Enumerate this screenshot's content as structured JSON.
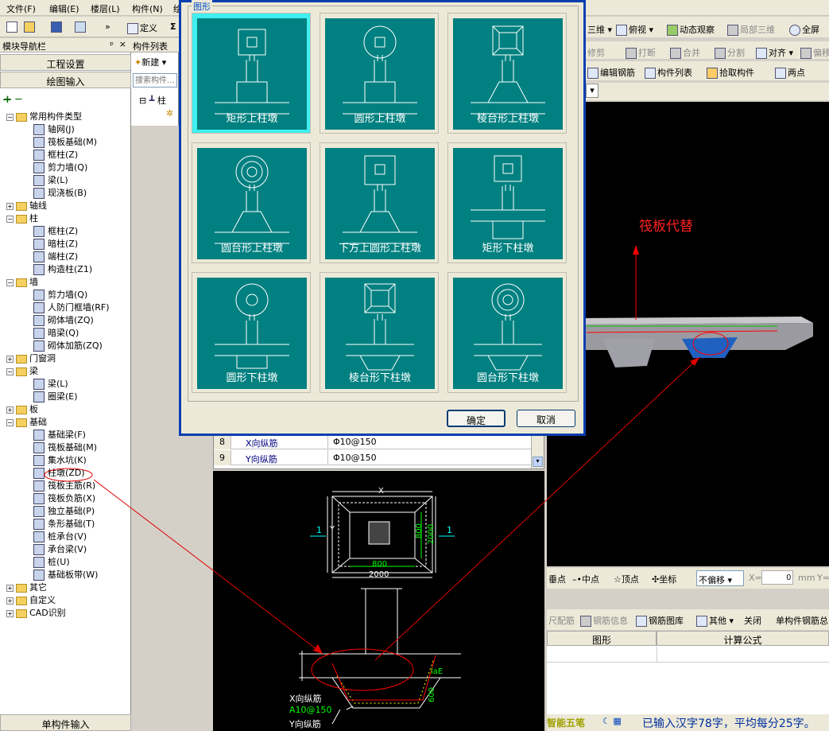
{
  "menu": [
    "文件(F)",
    "编辑(E)",
    "楼层(L)",
    "构件(N)",
    "绘"
  ],
  "toolbar": {
    "define_label": "定义",
    "sigma": "Σ",
    "chevron": "»"
  },
  "right_toolbar": {
    "row1": [
      "三维",
      "俯视",
      "动态观察",
      "局部三维",
      "全屏"
    ],
    "row2": [
      "修剪",
      "打断",
      "合并",
      "分割",
      "对齐",
      "偏移"
    ],
    "row3": [
      "编辑钢筋",
      "构件列表",
      "拾取构件",
      "两点"
    ]
  },
  "nav": {
    "title": "模块导航栏",
    "pin": "ᵖ",
    "close": "×",
    "project_settings": "工程设置",
    "drawing_input": "绘图输入",
    "single_input": "单构件输入",
    "tree": [
      {
        "label": "常用构件类型",
        "level": 0,
        "kind": "folder",
        "expanded": true
      },
      {
        "label": "轴网(J)",
        "level": 1,
        "kind": "item"
      },
      {
        "label": "筏板基础(M)",
        "level": 1,
        "kind": "item"
      },
      {
        "label": "框柱(Z)",
        "level": 1,
        "kind": "item"
      },
      {
        "label": "剪力墙(Q)",
        "level": 1,
        "kind": "item"
      },
      {
        "label": "梁(L)",
        "level": 1,
        "kind": "item"
      },
      {
        "label": "现浇板(B)",
        "level": 1,
        "kind": "item"
      },
      {
        "label": "轴线",
        "level": 0,
        "kind": "folder",
        "expanded": false
      },
      {
        "label": "柱",
        "level": 0,
        "kind": "folder",
        "expanded": true
      },
      {
        "label": "框柱(Z)",
        "level": 1,
        "kind": "item"
      },
      {
        "label": "暗柱(Z)",
        "level": 1,
        "kind": "item"
      },
      {
        "label": "端柱(Z)",
        "level": 1,
        "kind": "item"
      },
      {
        "label": "构造柱(Z1)",
        "level": 1,
        "kind": "item"
      },
      {
        "label": "墙",
        "level": 0,
        "kind": "folder",
        "expanded": true
      },
      {
        "label": "剪力墙(Q)",
        "level": 1,
        "kind": "item"
      },
      {
        "label": "人防门框墙(RF)",
        "level": 1,
        "kind": "item"
      },
      {
        "label": "砌体墙(ZQ)",
        "level": 1,
        "kind": "item"
      },
      {
        "label": "暗梁(Q)",
        "level": 1,
        "kind": "item"
      },
      {
        "label": "砌体加筋(ZQ)",
        "level": 1,
        "kind": "item"
      },
      {
        "label": "门窗洞",
        "level": 0,
        "kind": "folder",
        "expanded": false
      },
      {
        "label": "梁",
        "level": 0,
        "kind": "folder",
        "expanded": true
      },
      {
        "label": "梁(L)",
        "level": 1,
        "kind": "item"
      },
      {
        "label": "圈梁(E)",
        "level": 1,
        "kind": "item"
      },
      {
        "label": "板",
        "level": 0,
        "kind": "folder",
        "expanded": false
      },
      {
        "label": "基础",
        "level": 0,
        "kind": "folder",
        "expanded": true
      },
      {
        "label": "基础梁(F)",
        "level": 1,
        "kind": "item"
      },
      {
        "label": "筏板基础(M)",
        "level": 1,
        "kind": "item"
      },
      {
        "label": "集水坑(K)",
        "level": 1,
        "kind": "item"
      },
      {
        "label": "柱墩(ZD)",
        "level": 1,
        "kind": "item",
        "highlight": true
      },
      {
        "label": "筏板主筋(R)",
        "level": 1,
        "kind": "item"
      },
      {
        "label": "筏板负筋(X)",
        "level": 1,
        "kind": "item"
      },
      {
        "label": "独立基础(P)",
        "level": 1,
        "kind": "item"
      },
      {
        "label": "条形基础(T)",
        "level": 1,
        "kind": "item"
      },
      {
        "label": "桩承台(V)",
        "level": 1,
        "kind": "item"
      },
      {
        "label": "承台梁(V)",
        "level": 1,
        "kind": "item"
      },
      {
        "label": "桩(U)",
        "level": 1,
        "kind": "item"
      },
      {
        "label": "基础板带(W)",
        "level": 1,
        "kind": "item"
      },
      {
        "label": "其它",
        "level": 0,
        "kind": "folder",
        "expanded": false
      },
      {
        "label": "自定义",
        "level": 0,
        "kind": "folder",
        "expanded": false
      },
      {
        "label": "CAD识别",
        "level": 0,
        "kind": "folder",
        "expanded": false
      }
    ]
  },
  "component_list": {
    "title": "构件列表",
    "new_label": "新建",
    "search_placeholder": "搜索构件...",
    "root": "柱"
  },
  "dialog": {
    "group_label": "图形",
    "shapes": [
      "矩形上柱墩",
      "圆形上柱墩",
      "棱台形上柱墩",
      "圆台形上柱墩",
      "下方上圆形上柱墩",
      "矩形下柱墩",
      "圆形下柱墩",
      "棱台形下柱墩",
      "圆台形下柱墩"
    ],
    "ok": "确定",
    "cancel": "取消"
  },
  "properties": [
    {
      "no": "8",
      "name": "X向纵筋",
      "value": "Φ10@150"
    },
    {
      "no": "9",
      "name": "Y向纵筋",
      "value": "Φ10@150"
    }
  ],
  "cad": {
    "dim_x": "X",
    "dim_y": "Y",
    "dim_800_h": "800",
    "dim_2000_h": "2000",
    "dim_800_v": "800",
    "dim_2000_v": "2000",
    "section_mark": "1",
    "lae": "laE",
    "dim_600": "600",
    "x_rebar": "X向纵筋",
    "x_rebar_spec": "A10@150",
    "y_rebar": "Y向纵筋"
  },
  "view3d": {
    "annotation": "筏板代替"
  },
  "snapbar": [
    "垂点",
    "中点",
    "顶点",
    "坐标",
    "不偏移",
    "X=",
    "0",
    "mm",
    "Y="
  ],
  "rebarbar": [
    "尺配筋",
    "钢筋信息",
    "钢筋图库",
    "其他",
    "关闭",
    "单构件钢筋总"
  ],
  "rebar_table": {
    "col1": "图形",
    "col2": "计算公式"
  },
  "status": {
    "ime": "智能五笔",
    "text": "已输入汉字78字，平均每分25字。"
  },
  "colors": {
    "tile": "#008080",
    "selected": "#40f0f0",
    "annotation_red": "#ff0000",
    "dialog_border": "#0a3fb0"
  }
}
